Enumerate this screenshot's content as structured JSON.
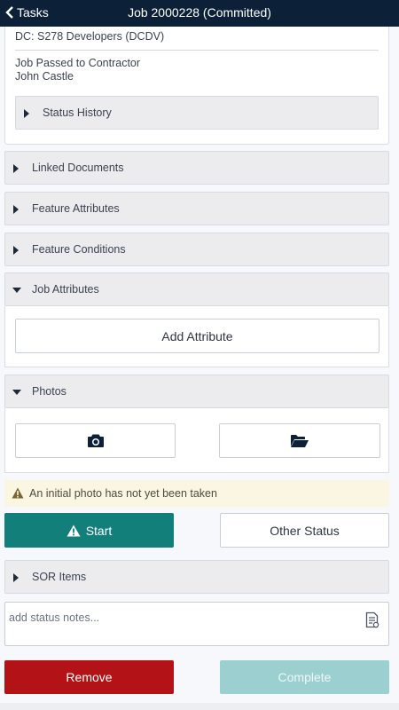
{
  "header": {
    "back_label": "Tasks",
    "title": "Job 2000228 (Committed)",
    "bg_color": "#0c2138"
  },
  "details": {
    "dc_line": "DC: S278 Developers (DCDV)",
    "status_line": "Job Passed to Contractor",
    "contractor": "John Castle",
    "status_history_label": "Status History"
  },
  "sections": {
    "linked_documents": "Linked Documents",
    "feature_attributes": "Feature Attributes",
    "feature_conditions": "Feature Conditions",
    "job_attributes": "Job Attributes",
    "add_attribute": "Add Attribute",
    "photos": "Photos",
    "sor_items": "SOR Items"
  },
  "warning": {
    "text": "An initial photo has not yet been taken",
    "color": "#fbf6e1"
  },
  "actions": {
    "start": "Start",
    "other_status": "Other Status",
    "remove": "Remove",
    "complete": "Complete",
    "start_color": "#137f7b",
    "remove_color": "#b31216",
    "complete_color": "#9ccfd0"
  },
  "notes": {
    "placeholder": "add status notes...",
    "value": ""
  },
  "icons": {
    "back": "chevron-left-icon",
    "camera": "camera-icon",
    "folder": "folder-open-icon",
    "warning": "warning-triangle-icon",
    "notes": "document-icon"
  }
}
